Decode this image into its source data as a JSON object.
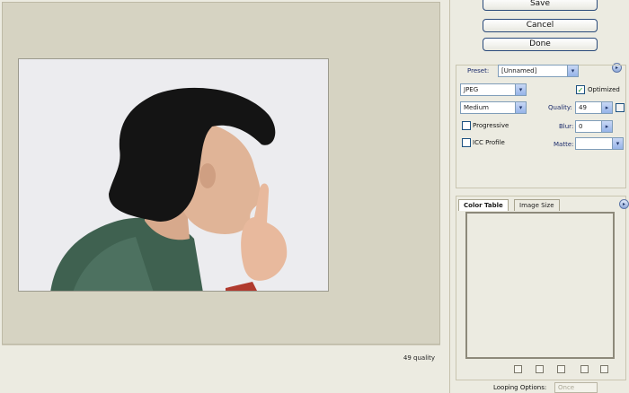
{
  "buttons": {
    "save": "Save",
    "cancel": "Cancel",
    "done": "Done"
  },
  "settings": {
    "preset_label": "Preset:",
    "preset_value": "[Unnamed]",
    "format_value": "JPEG",
    "compression_value": "Medium",
    "optimized_label": "Optimized",
    "optimized_checked": true,
    "quality_label": "Quality:",
    "quality_value": "49",
    "progressive_label": "Progressive",
    "icc_label": "ICC Profile",
    "blur_label": "Blur:",
    "blur_value": "0",
    "matte_label": "Matte:",
    "matte_value": ""
  },
  "tabs": {
    "color_table": "Color Table",
    "image_size": "Image Size"
  },
  "status": {
    "quality_readout": "49 quality"
  },
  "footer": {
    "looping_label": "Looping Options:",
    "looping_value": "Once"
  },
  "icons": {
    "checkmark": "✓",
    "dropdown_arrow": "▾",
    "menu_arrow": "▸"
  }
}
